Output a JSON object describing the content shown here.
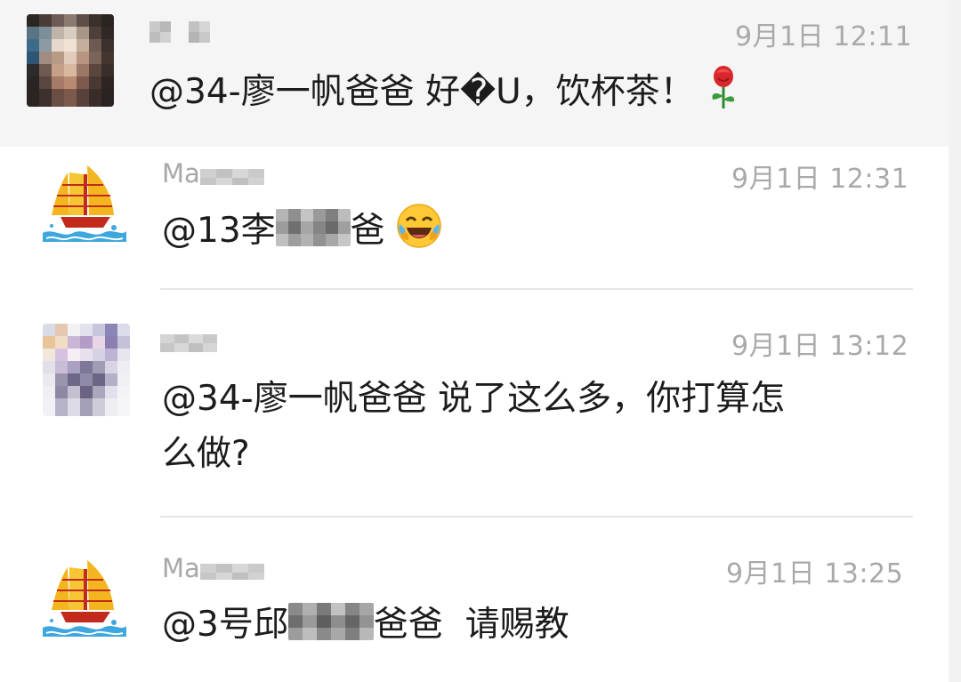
{
  "comments": [
    {
      "name_visible": "",
      "time": "9月1日 12:11",
      "mention": "@34-廖一帆爸爸",
      "text": " 好�U，饮杯茶！",
      "emoji": "rose-icon"
    },
    {
      "name_visible": "Ma",
      "time": "9月1日 12:31",
      "mention_prefix": "@13李",
      "mention_suffix": "爸",
      "emoji": "laughing-tears-emoji"
    },
    {
      "name_visible": "",
      "time": "9月1日 13:12",
      "mention": "@34-廖一帆爸爸",
      "text_line1": " 说了这么多，你打算怎",
      "text_line2": "么做?"
    },
    {
      "name_visible": "Ma",
      "time": "9月1日 13:25",
      "mention_prefix": "@3号邱",
      "mention_suffix": "爸爸",
      "text": "  请赐教"
    }
  ],
  "colors": {
    "text": "#1c1c1c",
    "meta": "#a9a9a9",
    "divider": "#e6e6e6"
  }
}
